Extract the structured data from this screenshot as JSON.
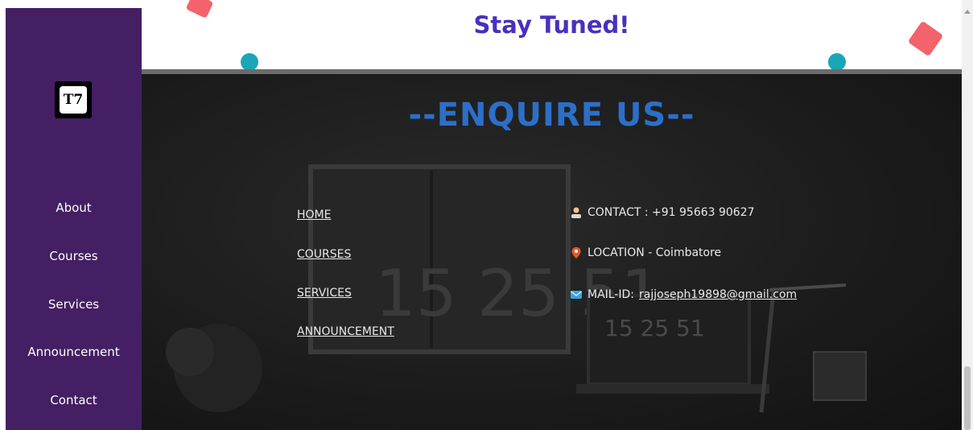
{
  "sidebar": {
    "logo_text": "T7",
    "items": [
      {
        "label": "About"
      },
      {
        "label": "Courses"
      },
      {
        "label": "Services"
      },
      {
        "label": "Announcement"
      },
      {
        "label": "Contact"
      }
    ],
    "background_color": "#451f63"
  },
  "banner": {
    "title": "Stay Tuned!",
    "title_color": "#4a2fc0",
    "decoration_colors": {
      "diamond": "#f2636b",
      "circle": "#1aa6b7"
    }
  },
  "footer": {
    "heading": "--ENQUIRE US--",
    "heading_color": "#2c6fc9",
    "links": [
      {
        "label": "HOME"
      },
      {
        "label": "COURSES"
      },
      {
        "label": "SERVICES"
      },
      {
        "label": "ANNOUNCEMENT"
      }
    ],
    "contact": {
      "phone": {
        "icon": "person-icon",
        "label": "CONTACT : +91 95663 90627"
      },
      "location": {
        "icon": "location-pin-icon",
        "label": "LOCATION - Coimbatore"
      },
      "mail": {
        "icon": "envelope-icon",
        "prefix": "MAIL-ID: ",
        "email": "rajjoseph19898@gmail.com"
      }
    }
  }
}
